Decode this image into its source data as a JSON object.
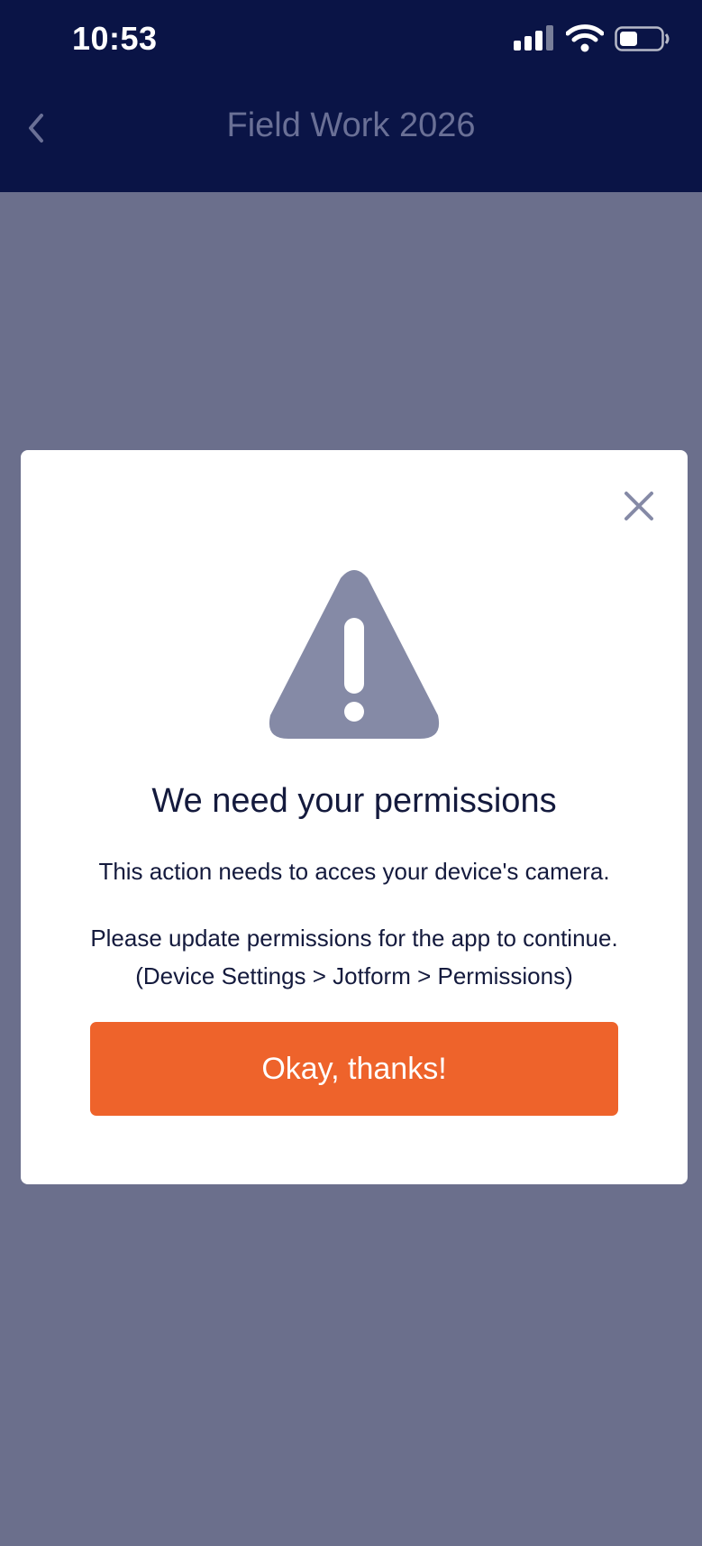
{
  "status_bar": {
    "time": "10:53",
    "icons": [
      "signal-icon",
      "wifi-icon",
      "battery-icon"
    ]
  },
  "nav": {
    "back_icon": "chevron-left-icon",
    "title": "Field Work 2026"
  },
  "dialog": {
    "close_icon": "close-icon",
    "warning_icon": "warning-triangle-icon",
    "title": "We need your permissions",
    "message": "This action needs to acces your device's camera.",
    "instruction_line1": "Please update permissions for the app to continue.",
    "instruction_line2": "(Device Settings > Jotform > Permissions)",
    "confirm_label": "Okay, thanks!"
  },
  "colors": {
    "header_bg": "#0a1446",
    "overlay_bg": "#6b6f8c",
    "accent_orange": "#ee632b",
    "icon_gray": "#858aa6",
    "text_dark": "#141a3d"
  }
}
